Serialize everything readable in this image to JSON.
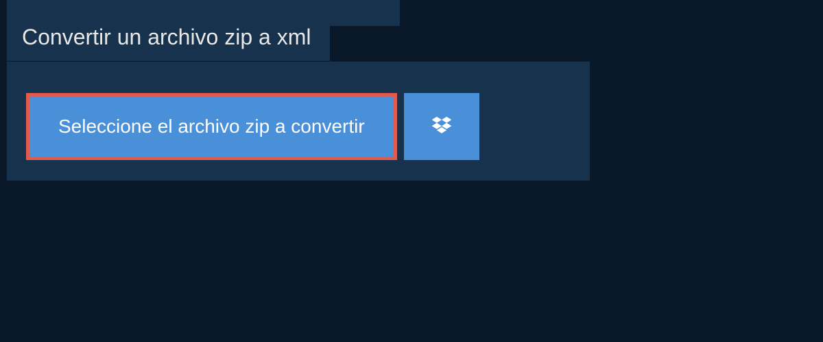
{
  "header": {
    "title": "Convertir un archivo zip a xml"
  },
  "actions": {
    "select_file_label": "Seleccione el archivo zip a convertir"
  },
  "colors": {
    "background": "#0a1929",
    "panel": "#17324c",
    "button": "#4a90d9",
    "highlight_border": "#e05a4f"
  }
}
